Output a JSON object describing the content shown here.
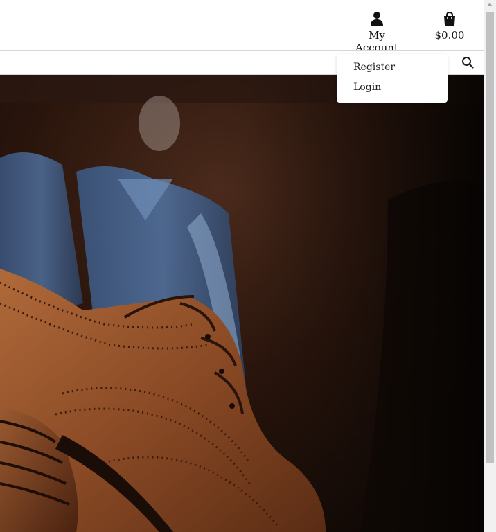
{
  "header": {
    "account_label": "My Account",
    "account_icon": "user-icon",
    "cart_total": "$0.00",
    "cart_icon": "shopping-bag-icon"
  },
  "search": {
    "placeholder": "",
    "button_icon": "search-icon"
  },
  "account_menu": {
    "items": [
      {
        "label": "Register"
      },
      {
        "label": "Login"
      }
    ]
  },
  "hero": {
    "image": "brown-brogue-shoes-with-suits-photo"
  },
  "colors": {
    "leather": "#8a4a25",
    "dark_background": "#1c100a",
    "suit_blue": "#4a6a96"
  }
}
